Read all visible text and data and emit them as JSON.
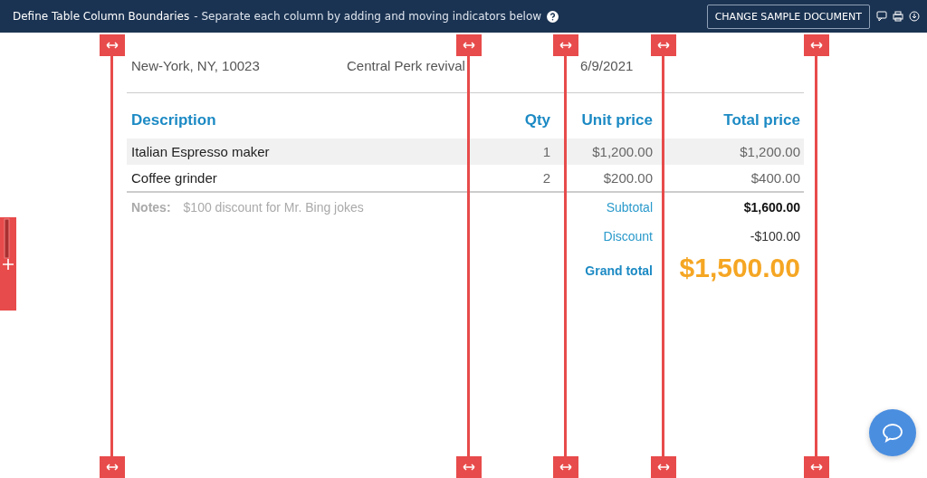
{
  "header": {
    "title": "Define Table Column Boundaries",
    "subtitle": "- Separate each column by adding and moving indicators below",
    "button": "CHANGE SAMPLE DOCUMENT"
  },
  "document": {
    "address_line": [
      "New-York, NY, 10023",
      "Central Perk revival",
      "6/9/2021"
    ],
    "columns": [
      "Description",
      "Qty",
      "Unit price",
      "Total price"
    ],
    "rows": [
      [
        "Italian Espresso maker",
        "1",
        "$1,200.00",
        "$1,200.00"
      ],
      [
        "Coffee grinder",
        "2",
        "$200.00",
        "$400.00"
      ]
    ],
    "notes_label": "Notes:",
    "notes": "$100 discount for Mr. Bing jokes",
    "summary": [
      {
        "kind": "subtotal",
        "label": "Subtotal",
        "value": "$1,600.00"
      },
      {
        "kind": "discount",
        "label": "Discount",
        "value": "-$100.00"
      },
      {
        "kind": "grand",
        "label": "Grand total",
        "value": "$1,500.00"
      }
    ]
  }
}
